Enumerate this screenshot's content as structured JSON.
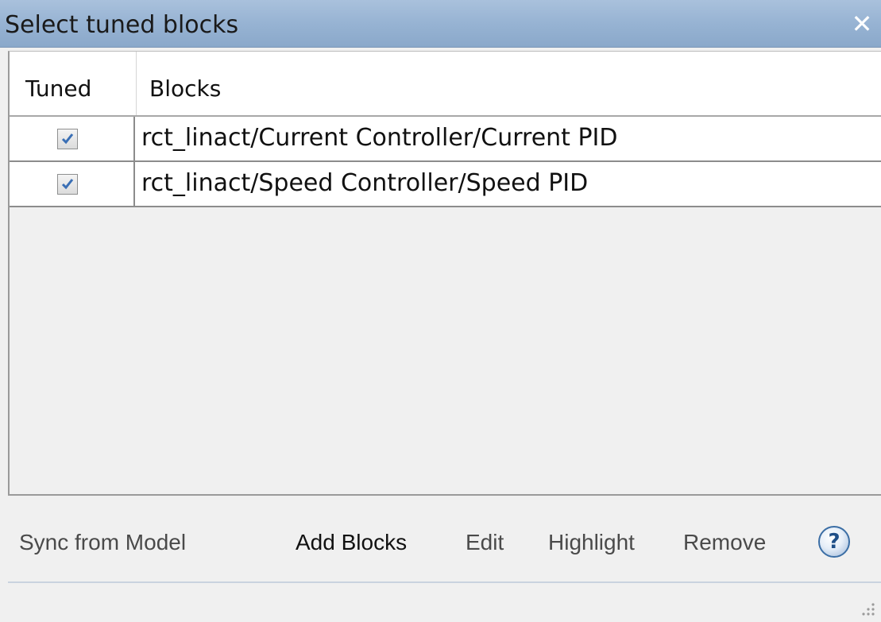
{
  "window": {
    "title": "Select tuned blocks",
    "close_glyph": "✕"
  },
  "table": {
    "columns": [
      "Tuned",
      "Blocks"
    ],
    "rows": [
      {
        "tuned": true,
        "block": "rct_linact/Current Controller/Current PID"
      },
      {
        "tuned": true,
        "block": "rct_linact/Speed Controller/Speed PID"
      }
    ]
  },
  "toolbar": {
    "sync_label": "Sync from Model",
    "add_label": "Add Blocks",
    "edit_label": "Edit",
    "highlight_label": "Highlight",
    "remove_label": "Remove",
    "help_glyph": "?"
  },
  "colors": {
    "titlebar": "#97b3d3",
    "background": "#f0f0f0",
    "check_mark": "#3a6fb5"
  },
  "icons": {
    "close": "close-icon",
    "help": "help-icon",
    "checkbox": "checkbox-checked-icon",
    "resize": "resize-grip-icon"
  }
}
